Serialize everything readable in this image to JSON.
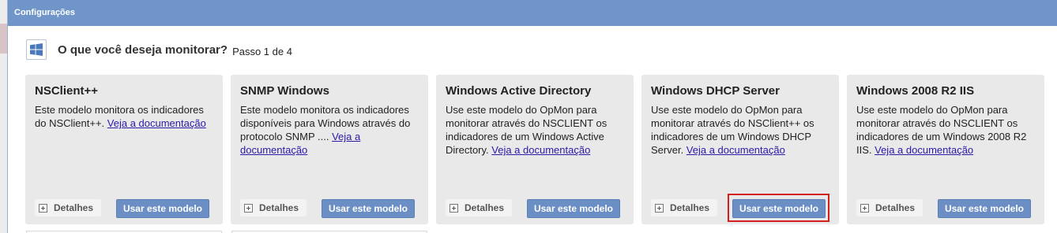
{
  "dialog": {
    "title": "Configurações"
  },
  "header": {
    "title": "O que você deseja monitorar?",
    "step": "Passo 1 de 4",
    "icon": "windows-icon"
  },
  "cards": [
    {
      "title": "NSClient++",
      "desc": "Este modelo monitora os indicadores do NSClient++. ",
      "link": "Veja a documentação",
      "details_label": "Detalhes",
      "use_label": "Usar este modelo"
    },
    {
      "title": "SNMP Windows",
      "desc": "Este modelo monitora os indicadores disponíveis para Windows através do protocolo SNMP .... ",
      "link": "Veja a documentação",
      "details_label": "Detalhes",
      "use_label": "Usar este modelo"
    },
    {
      "title": "Windows Active Directory",
      "desc": "Use este modelo do OpMon para monitorar através do NSCLIENT os indicadores de um Windows Active Directory. ",
      "link": "Veja a documentação",
      "details_label": "Detalhes",
      "use_label": "Usar este modelo"
    },
    {
      "title": "Windows DHCP Server",
      "desc": "Use este modelo do OpMon para monitorar através do NSClient++ os indicadores de um Windows DHCP Server. ",
      "link": "Veja a documentação",
      "details_label": "Detalhes",
      "use_label": "Usar este modelo"
    },
    {
      "title": "Windows 2008 R2 IIS",
      "desc": "Use este modelo do OpMon para monitorar através do NSCLIENT os indicadores de um Windows 2008 R2 IIS. ",
      "link": "Veja a documentação",
      "details_label": "Detalhes",
      "use_label": "Usar este modelo"
    }
  ],
  "colors": {
    "titlebar": "#7096c9",
    "primary_button": "#6b8fc4",
    "highlight": "#d41f1f",
    "link": "#2a1aa8"
  }
}
